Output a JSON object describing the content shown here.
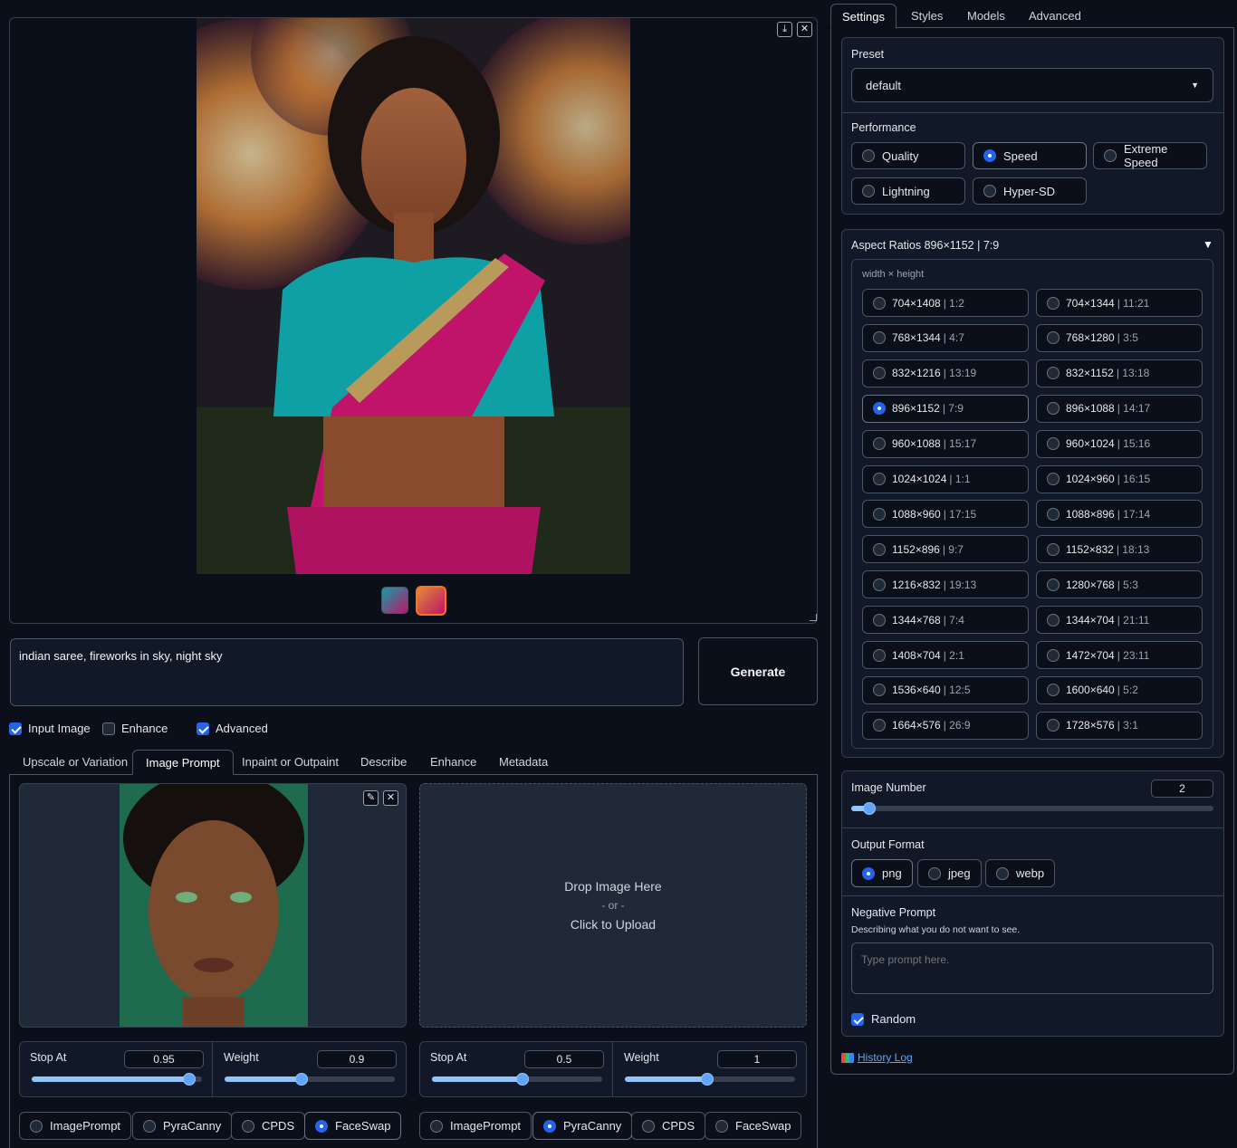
{
  "gallery": {
    "download_icon": "download-icon",
    "close_icon": "close-icon",
    "thumbnails": [
      "thumbnail-1",
      "thumbnail-2"
    ]
  },
  "prompt": {
    "value": "indian saree, fireworks in sky, night sky"
  },
  "generate_label": "Generate",
  "toggles": [
    {
      "label": "Input Image",
      "checked": true
    },
    {
      "label": "Enhance",
      "checked": false
    },
    {
      "label": "Advanced",
      "checked": true
    }
  ],
  "input_tabs": [
    "Upscale or Variation",
    "Image Prompt",
    "Inpaint or Outpaint",
    "Describe",
    "Enhance",
    "Metadata"
  ],
  "input_tabs_active": "Image Prompt",
  "upload": {
    "line1": "Drop Image Here",
    "line2": "- or -",
    "line3": "Click to Upload"
  },
  "image_prompts": [
    {
      "stop_at_label": "Stop At",
      "stop_at": "0.95",
      "weight_label": "Weight",
      "weight": "0.9",
      "types": [
        "ImagePrompt",
        "PyraCanny",
        "CPDS",
        "FaceSwap"
      ],
      "selected_type": "FaceSwap"
    },
    {
      "stop_at_label": "Stop At",
      "stop_at": "0.5",
      "weight_label": "Weight",
      "weight": "1",
      "types": [
        "ImagePrompt",
        "PyraCanny",
        "CPDS",
        "FaceSwap"
      ],
      "selected_type": "PyraCanny"
    }
  ],
  "settings_tabs": [
    "Settings",
    "Styles",
    "Models",
    "Advanced"
  ],
  "settings_tabs_active": "Settings",
  "preset": {
    "label": "Preset",
    "value": "default"
  },
  "performance": {
    "label": "Performance",
    "options": [
      "Quality",
      "Speed",
      "Extreme Speed",
      "Lightning",
      "Hyper-SD"
    ],
    "selected": "Speed"
  },
  "aspect": {
    "title": "Aspect Ratios 896×1152 | 7:9",
    "sublabel": "width × height",
    "selected": "896×1152",
    "options": [
      {
        "size": "704×1408",
        "ratio": "| 1:2"
      },
      {
        "size": "704×1344",
        "ratio": "| 11:21"
      },
      {
        "size": "768×1344",
        "ratio": "| 4:7"
      },
      {
        "size": "768×1280",
        "ratio": "| 3:5"
      },
      {
        "size": "832×1216",
        "ratio": "| 13:19"
      },
      {
        "size": "832×1152",
        "ratio": "| 13:18"
      },
      {
        "size": "896×1152",
        "ratio": "| 7:9"
      },
      {
        "size": "896×1088",
        "ratio": "| 14:17"
      },
      {
        "size": "960×1088",
        "ratio": "| 15:17"
      },
      {
        "size": "960×1024",
        "ratio": "| 15:16"
      },
      {
        "size": "1024×1024",
        "ratio": "| 1:1"
      },
      {
        "size": "1024×960",
        "ratio": "| 16:15"
      },
      {
        "size": "1088×960",
        "ratio": "| 17:15"
      },
      {
        "size": "1088×896",
        "ratio": "| 17:14"
      },
      {
        "size": "1152×896",
        "ratio": "| 9:7"
      },
      {
        "size": "1152×832",
        "ratio": "| 18:13"
      },
      {
        "size": "1216×832",
        "ratio": "| 19:13"
      },
      {
        "size": "1280×768",
        "ratio": "| 5:3"
      },
      {
        "size": "1344×768",
        "ratio": "| 7:4"
      },
      {
        "size": "1344×704",
        "ratio": "| 21:11"
      },
      {
        "size": "1408×704",
        "ratio": "| 2:1"
      },
      {
        "size": "1472×704",
        "ratio": "| 23:11"
      },
      {
        "size": "1536×640",
        "ratio": "| 12:5"
      },
      {
        "size": "1600×640",
        "ratio": "| 5:2"
      },
      {
        "size": "1664×576",
        "ratio": "| 26:9"
      },
      {
        "size": "1728×576",
        "ratio": "| 3:1"
      }
    ]
  },
  "image_number": {
    "label": "Image Number",
    "value": "2",
    "fraction": 0.03
  },
  "output_format": {
    "label": "Output Format",
    "options": [
      "png",
      "jpeg",
      "webp"
    ],
    "selected": "png"
  },
  "negative_prompt": {
    "label": "Negative Prompt",
    "hint": "Describing what you do not want to see.",
    "placeholder": "Type prompt here."
  },
  "random": {
    "label": "Random",
    "checked": true
  },
  "history_log": "History Log",
  "colors": {
    "accent": "#2563eb",
    "background": "#0b0f19",
    "slider_fill": "#93c5fd"
  }
}
